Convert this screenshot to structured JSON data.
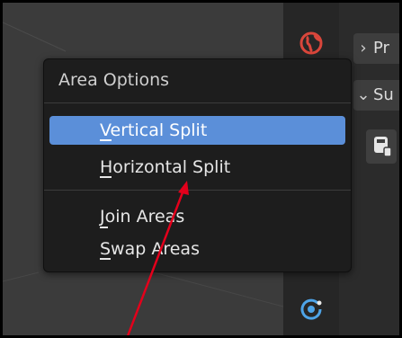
{
  "colors": {
    "viewport_bg": "#3b3b3b",
    "menu_bg": "#1d1d1d",
    "menu_highlight": "#5b8fd9",
    "annotation_arrow": "#e3001b"
  },
  "toolbar_icons": [
    "world-icon",
    "orbit-icon"
  ],
  "properties_panel": {
    "headers": [
      {
        "label": "Pr",
        "state": "collapsed",
        "chevron": "chevron-right-icon"
      },
      {
        "label": "Su",
        "state": "expanded",
        "chevron": "chevron-down-icon"
      }
    ],
    "icon": "panel-document-icon"
  },
  "area_menu": {
    "title": "Area Options",
    "items": [
      {
        "label": "Vertical Split",
        "highlighted": true,
        "underline_char": "V"
      },
      {
        "label": "Horizontal Split",
        "highlighted": false,
        "underline_char": "H"
      },
      {
        "label": "Join Areas",
        "highlighted": false,
        "underline_char": "J"
      },
      {
        "label": "Swap Areas",
        "highlighted": false,
        "underline_char": "S"
      }
    ]
  },
  "annotation": {
    "type": "arrow",
    "color": "#e3001b"
  }
}
